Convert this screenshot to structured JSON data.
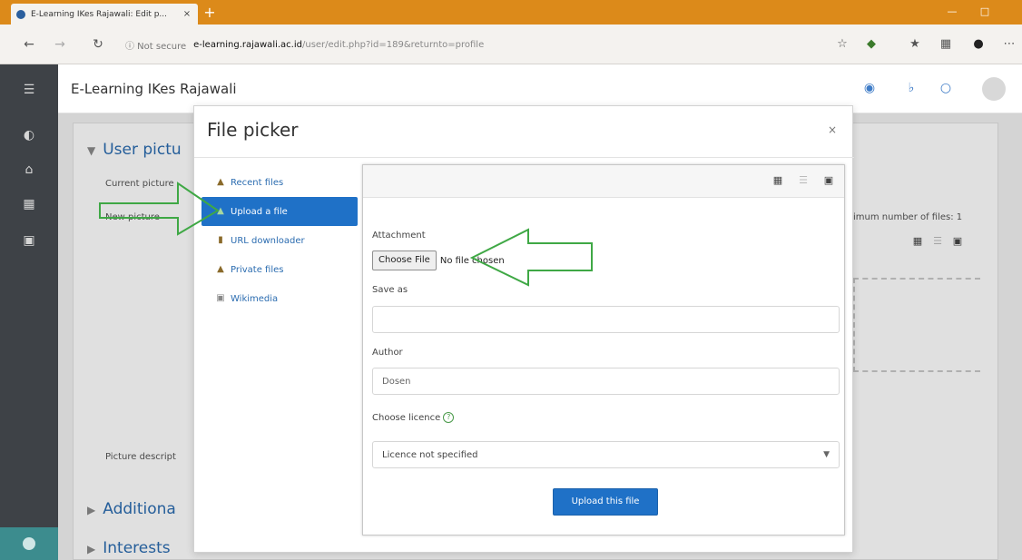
{
  "browser": {
    "tab_title": "E-Learning IKes Rajawali: Edit p...",
    "tab_close": "×",
    "new_tab": "+",
    "url_security": "ⓘ Not secure",
    "url_host": "e-learning.rajawali.ac.id",
    "url_path": "/user/edit.php?id=189&returnto=profile"
  },
  "site": {
    "name": "E-Learning IKes Rajawali"
  },
  "page": {
    "section_user_picture": "User pictu",
    "current_picture_label": "Current picture",
    "new_picture_label": "New picture",
    "max_files_label": "imum number of files: 1",
    "picture_description_label": "Picture descript",
    "section_additional": "Additiona",
    "section_interests": "Interests"
  },
  "modal": {
    "title": "File picker",
    "close": "×",
    "repositories": [
      {
        "label": "Recent files",
        "icon": "recent-files-icon"
      },
      {
        "label": "Upload a file",
        "icon": "upload-icon"
      },
      {
        "label": "URL downloader",
        "icon": "url-downloader-icon"
      },
      {
        "label": "Private files",
        "icon": "private-files-icon"
      },
      {
        "label": "Wikimedia",
        "icon": "wikimedia-icon"
      }
    ],
    "attachment_label": "Attachment",
    "choose_file": "Choose File",
    "no_file": "No file chosen",
    "save_as_label": "Save as",
    "save_as_value": "",
    "author_label": "Author",
    "author_value": "Dosen",
    "licence_label": "Choose licence",
    "licence_value": "Licence not specified",
    "upload_button": "Upload this file"
  },
  "colors": {
    "tabstrip": "#dc8a1a",
    "sidebar": "#3e4247",
    "primary": "#1f71c7",
    "annotation_arrow": "#3fa845"
  }
}
